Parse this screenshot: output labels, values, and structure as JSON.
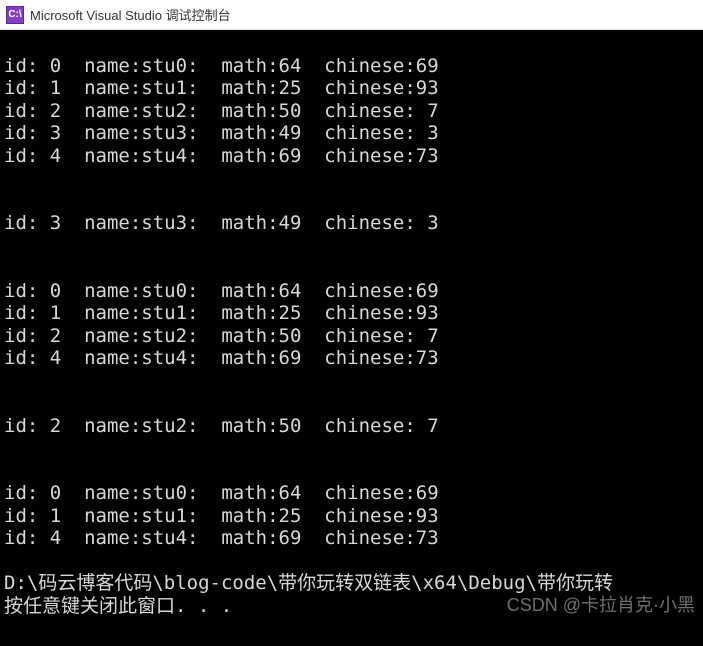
{
  "window": {
    "icon_text": "C:\\",
    "title": "Microsoft Visual Studio 调试控制台"
  },
  "console_output": {
    "block1": [
      "id: 0  name:stu0:  math:64  chinese:69",
      "id: 1  name:stu1:  math:25  chinese:93",
      "id: 2  name:stu2:  math:50  chinese: 7",
      "id: 3  name:stu3:  math:49  chinese: 3",
      "id: 4  name:stu4:  math:69  chinese:73"
    ],
    "block2": [
      "id: 3  name:stu3:  math:49  chinese: 3"
    ],
    "block3": [
      "id: 0  name:stu0:  math:64  chinese:69",
      "id: 1  name:stu1:  math:25  chinese:93",
      "id: 2  name:stu2:  math:50  chinese: 7",
      "id: 4  name:stu4:  math:69  chinese:73"
    ],
    "block4": [
      "id: 2  name:stu2:  math:50  chinese: 7"
    ],
    "block5": [
      "id: 0  name:stu0:  math:64  chinese:69",
      "id: 1  name:stu1:  math:25  chinese:93",
      "id: 4  name:stu4:  math:69  chinese:73"
    ],
    "footer_path": "D:\\码云博客代码\\blog-code\\带你玩转双链表\\x64\\Debug\\带你玩转",
    "footer_prompt": "按任意键关闭此窗口. . ."
  },
  "watermark": "CSDN @卡拉肖克·小黑"
}
